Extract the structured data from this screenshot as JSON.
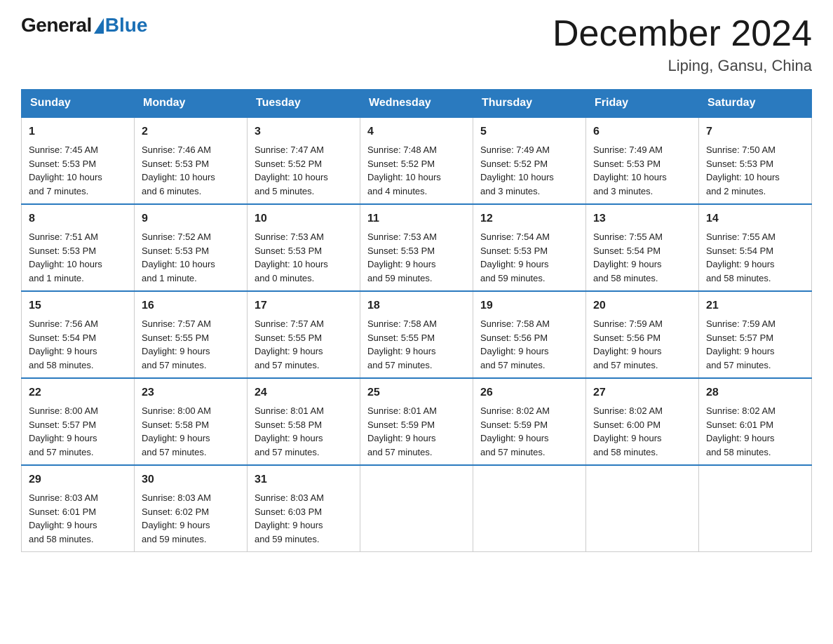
{
  "header": {
    "logo_general": "General",
    "logo_blue": "Blue",
    "month_title": "December 2024",
    "location": "Liping, Gansu, China"
  },
  "days_of_week": [
    "Sunday",
    "Monday",
    "Tuesday",
    "Wednesday",
    "Thursday",
    "Friday",
    "Saturday"
  ],
  "weeks": [
    [
      {
        "day": "1",
        "info": "Sunrise: 7:45 AM\nSunset: 5:53 PM\nDaylight: 10 hours\nand 7 minutes."
      },
      {
        "day": "2",
        "info": "Sunrise: 7:46 AM\nSunset: 5:53 PM\nDaylight: 10 hours\nand 6 minutes."
      },
      {
        "day": "3",
        "info": "Sunrise: 7:47 AM\nSunset: 5:52 PM\nDaylight: 10 hours\nand 5 minutes."
      },
      {
        "day": "4",
        "info": "Sunrise: 7:48 AM\nSunset: 5:52 PM\nDaylight: 10 hours\nand 4 minutes."
      },
      {
        "day": "5",
        "info": "Sunrise: 7:49 AM\nSunset: 5:52 PM\nDaylight: 10 hours\nand 3 minutes."
      },
      {
        "day": "6",
        "info": "Sunrise: 7:49 AM\nSunset: 5:53 PM\nDaylight: 10 hours\nand 3 minutes."
      },
      {
        "day": "7",
        "info": "Sunrise: 7:50 AM\nSunset: 5:53 PM\nDaylight: 10 hours\nand 2 minutes."
      }
    ],
    [
      {
        "day": "8",
        "info": "Sunrise: 7:51 AM\nSunset: 5:53 PM\nDaylight: 10 hours\nand 1 minute."
      },
      {
        "day": "9",
        "info": "Sunrise: 7:52 AM\nSunset: 5:53 PM\nDaylight: 10 hours\nand 1 minute."
      },
      {
        "day": "10",
        "info": "Sunrise: 7:53 AM\nSunset: 5:53 PM\nDaylight: 10 hours\nand 0 minutes."
      },
      {
        "day": "11",
        "info": "Sunrise: 7:53 AM\nSunset: 5:53 PM\nDaylight: 9 hours\nand 59 minutes."
      },
      {
        "day": "12",
        "info": "Sunrise: 7:54 AM\nSunset: 5:53 PM\nDaylight: 9 hours\nand 59 minutes."
      },
      {
        "day": "13",
        "info": "Sunrise: 7:55 AM\nSunset: 5:54 PM\nDaylight: 9 hours\nand 58 minutes."
      },
      {
        "day": "14",
        "info": "Sunrise: 7:55 AM\nSunset: 5:54 PM\nDaylight: 9 hours\nand 58 minutes."
      }
    ],
    [
      {
        "day": "15",
        "info": "Sunrise: 7:56 AM\nSunset: 5:54 PM\nDaylight: 9 hours\nand 58 minutes."
      },
      {
        "day": "16",
        "info": "Sunrise: 7:57 AM\nSunset: 5:55 PM\nDaylight: 9 hours\nand 57 minutes."
      },
      {
        "day": "17",
        "info": "Sunrise: 7:57 AM\nSunset: 5:55 PM\nDaylight: 9 hours\nand 57 minutes."
      },
      {
        "day": "18",
        "info": "Sunrise: 7:58 AM\nSunset: 5:55 PM\nDaylight: 9 hours\nand 57 minutes."
      },
      {
        "day": "19",
        "info": "Sunrise: 7:58 AM\nSunset: 5:56 PM\nDaylight: 9 hours\nand 57 minutes."
      },
      {
        "day": "20",
        "info": "Sunrise: 7:59 AM\nSunset: 5:56 PM\nDaylight: 9 hours\nand 57 minutes."
      },
      {
        "day": "21",
        "info": "Sunrise: 7:59 AM\nSunset: 5:57 PM\nDaylight: 9 hours\nand 57 minutes."
      }
    ],
    [
      {
        "day": "22",
        "info": "Sunrise: 8:00 AM\nSunset: 5:57 PM\nDaylight: 9 hours\nand 57 minutes."
      },
      {
        "day": "23",
        "info": "Sunrise: 8:00 AM\nSunset: 5:58 PM\nDaylight: 9 hours\nand 57 minutes."
      },
      {
        "day": "24",
        "info": "Sunrise: 8:01 AM\nSunset: 5:58 PM\nDaylight: 9 hours\nand 57 minutes."
      },
      {
        "day": "25",
        "info": "Sunrise: 8:01 AM\nSunset: 5:59 PM\nDaylight: 9 hours\nand 57 minutes."
      },
      {
        "day": "26",
        "info": "Sunrise: 8:02 AM\nSunset: 5:59 PM\nDaylight: 9 hours\nand 57 minutes."
      },
      {
        "day": "27",
        "info": "Sunrise: 8:02 AM\nSunset: 6:00 PM\nDaylight: 9 hours\nand 58 minutes."
      },
      {
        "day": "28",
        "info": "Sunrise: 8:02 AM\nSunset: 6:01 PM\nDaylight: 9 hours\nand 58 minutes."
      }
    ],
    [
      {
        "day": "29",
        "info": "Sunrise: 8:03 AM\nSunset: 6:01 PM\nDaylight: 9 hours\nand 58 minutes."
      },
      {
        "day": "30",
        "info": "Sunrise: 8:03 AM\nSunset: 6:02 PM\nDaylight: 9 hours\nand 59 minutes."
      },
      {
        "day": "31",
        "info": "Sunrise: 8:03 AM\nSunset: 6:03 PM\nDaylight: 9 hours\nand 59 minutes."
      },
      null,
      null,
      null,
      null
    ]
  ]
}
